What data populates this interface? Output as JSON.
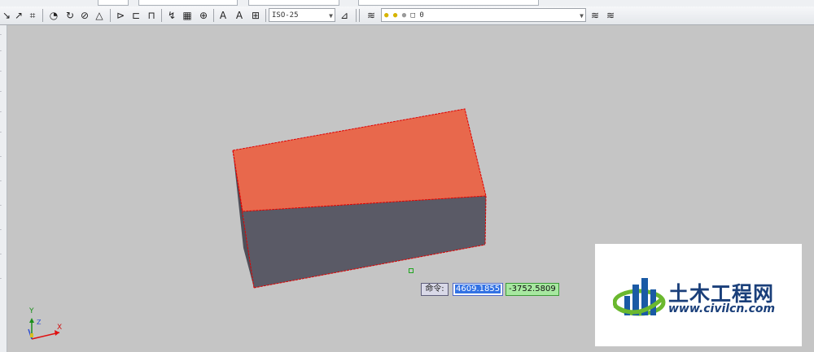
{
  "toolbar": {
    "dimstyle_value": "ISO-25",
    "layer_value": "0",
    "icons": [
      "line-icon",
      "arc-icon",
      "dimension-icon",
      "circle-icon",
      "rotate-icon",
      "offset-icon",
      "angle-icon",
      "measure-icon",
      "text-icon",
      "grid-icon",
      "target-icon",
      "multiline-text-icon",
      "single-text-icon",
      "table-icon",
      "layer-manager-icon",
      "lightbulb-icon",
      "sun-icon",
      "lock-icon",
      "color-icon",
      "layer-previous-icon",
      "layer-states-icon"
    ]
  },
  "command_line": {
    "prompt_label": "命令:",
    "x_value": "4609.1855",
    "y_value": "-3752.5809"
  },
  "ucs": {
    "x_label": "X",
    "y_label": "Y",
    "z_label": "Z"
  },
  "colors": {
    "canvas": "#c5c5c5",
    "top_face": "#e8684c",
    "side_face": "#5a5a66",
    "edge": "#e00000",
    "accent": "#3372e4"
  },
  "watermark": {
    "title": "土木工程网",
    "url": "www.civilcn.com"
  }
}
